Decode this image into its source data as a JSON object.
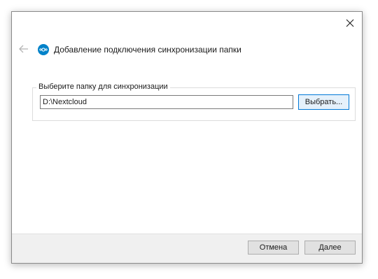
{
  "window": {
    "title": "Добавление подключения синхронизации папки",
    "close_icon": "close-icon",
    "back_icon": "back-arrow-icon",
    "logo_icon": "nextcloud-logo-icon"
  },
  "folder_group": {
    "caption": "Выберите папку для синхронизации",
    "path_value": "D:\\Nextcloud",
    "choose_label": "Выбрать..."
  },
  "footer": {
    "cancel_label": "Отмена",
    "next_label": "Далее"
  },
  "colors": {
    "accent": "#0078d7",
    "brand": "#0082c9",
    "footer_bg": "#f0f0f0"
  }
}
